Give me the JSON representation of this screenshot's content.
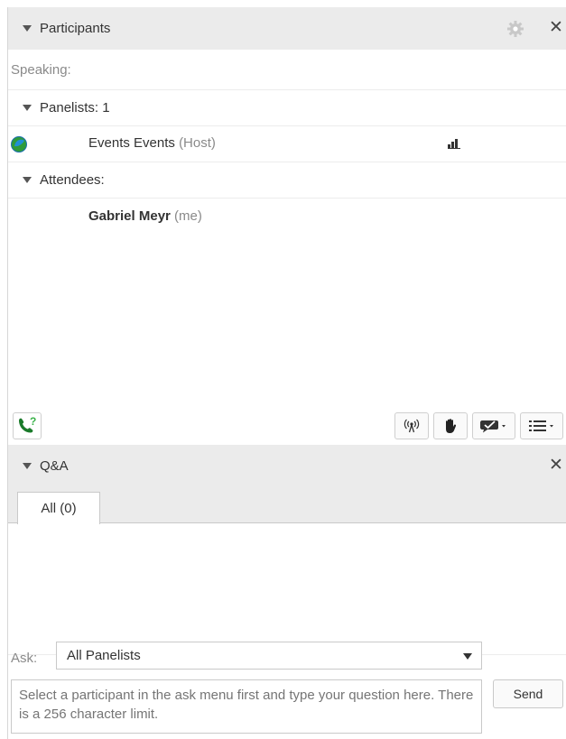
{
  "participants": {
    "title": "Participants",
    "speaking_label": "Speaking:",
    "panelists": {
      "label": "Panelists: 1"
    },
    "host": {
      "name": "Events Events",
      "role": "(Host)"
    },
    "attendees": {
      "label": "Attendees:"
    },
    "attendee": {
      "name": "Gabriel Meyr",
      "tag": "(me)"
    },
    "toolbar": {
      "icons": [
        "phone-help-icon",
        "broadcast-icon",
        "raise-hand-icon",
        "chat-bubble-dropdown-icon",
        "list-menu-icon"
      ]
    }
  },
  "qa": {
    "title": "Q&A",
    "tabs": [
      {
        "label": "All (0)"
      }
    ],
    "ask_label": "Ask:",
    "ask_selected": "All Panelists",
    "question_placeholder": "Select a participant in the ask menu first and type your question here. There is a 256 character limit.",
    "send_label": "Send"
  },
  "colors": {
    "header_bg": "#ebebeb",
    "muted_text": "#8a8a8a",
    "accent_green": "#2e9b3a",
    "presence_blue": "#1f8fd6"
  }
}
